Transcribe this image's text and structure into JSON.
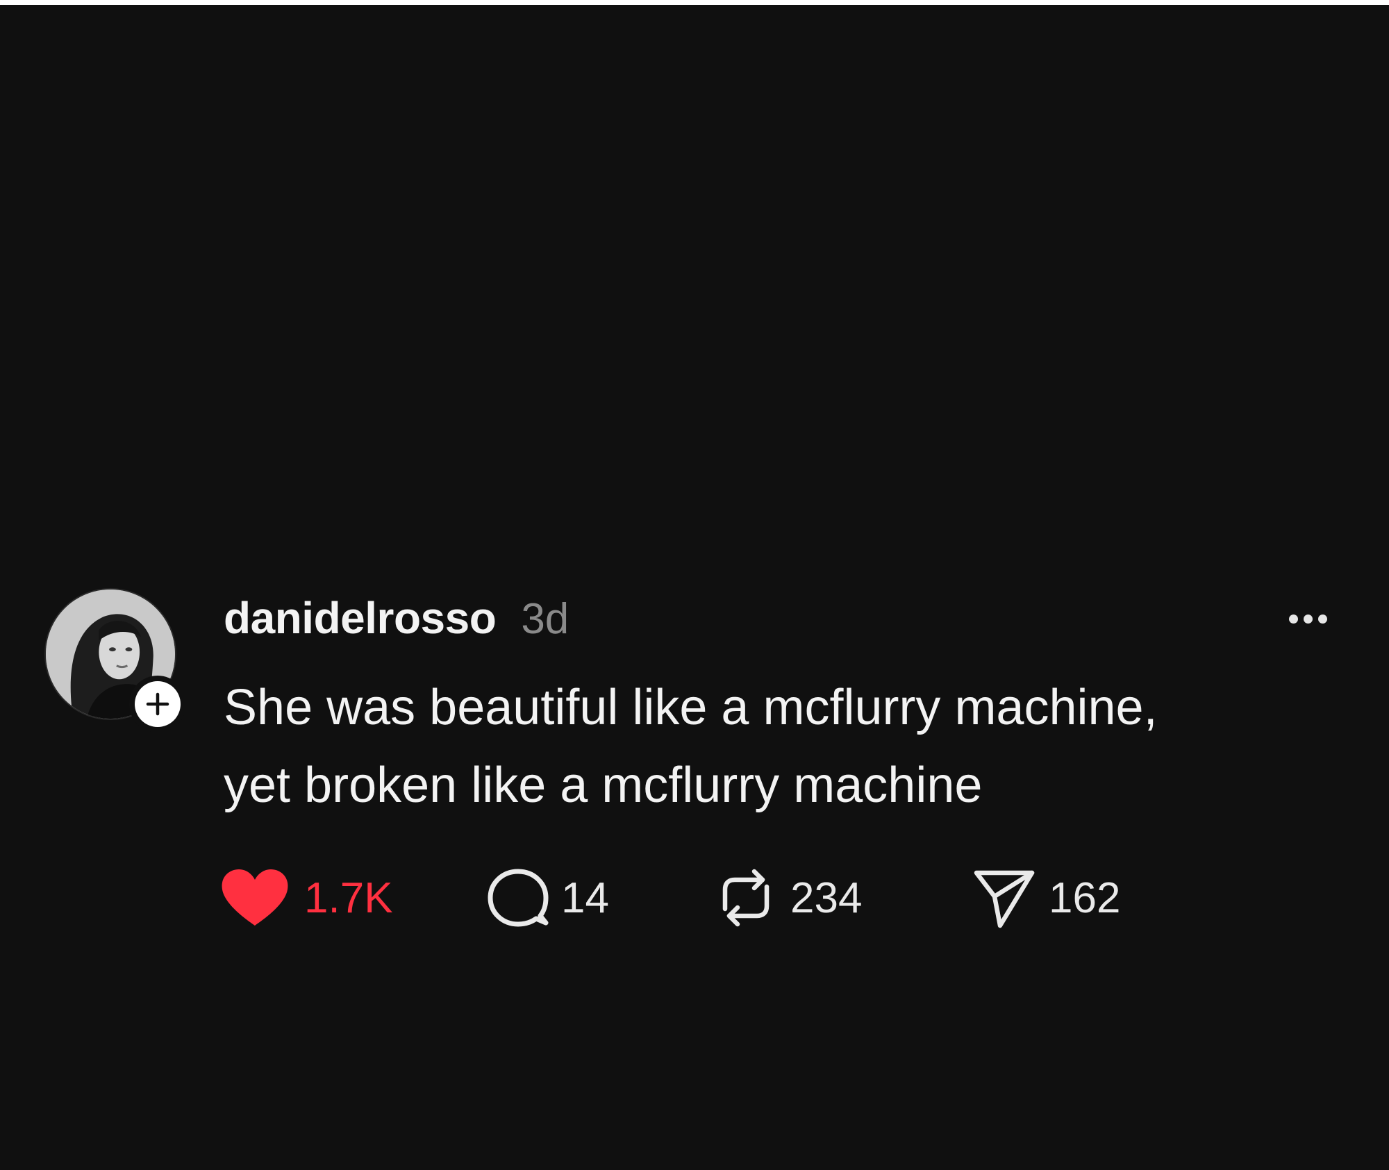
{
  "post": {
    "author": {
      "username": "danidelrosso",
      "timestamp": "3d"
    },
    "text_lines": [
      "She was beautiful like a mcflurry machine,",
      "yet broken like a mcflurry machine"
    ],
    "actions": {
      "likes": "1.7K",
      "replies": "14",
      "reposts": "234",
      "shares": "162"
    },
    "liked": true
  },
  "icons": {
    "follow": "plus-icon",
    "more": "more-horizontal-icon",
    "like": "heart-icon",
    "reply": "speech-bubble-icon",
    "repost": "repost-icon",
    "share": "paper-plane-icon"
  },
  "colors": {
    "background": "#101010",
    "text": "#f3f3f3",
    "muted": "#8a8a8a",
    "like_active": "#ff3040"
  }
}
